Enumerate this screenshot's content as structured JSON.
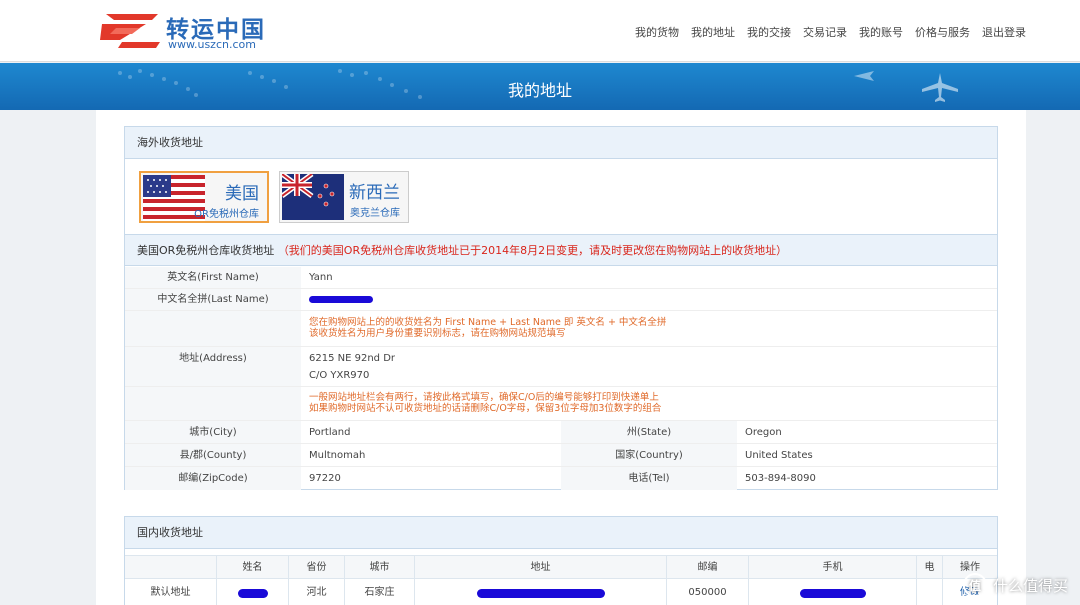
{
  "header": {
    "logo_name": "转运中国",
    "logo_url": "www.uszcn.com",
    "nav": [
      "我的货物",
      "我的地址",
      "我的交接",
      "交易记录",
      "我的账号",
      "价格与服务",
      "退出登录"
    ]
  },
  "banner": {
    "title": "我的地址"
  },
  "overseas": {
    "heading": "海外收货地址",
    "warehouses": [
      {
        "name": "美国",
        "sub": "OR免税州仓库"
      },
      {
        "name": "新西兰",
        "sub": "奥克兰仓库"
      }
    ],
    "address_heading": "美国OR免税州仓库收货地址",
    "address_notice": "（我们的美国OR免税州仓库收货地址已于2014年8月2日变更，请及时更改您在购物网站上的收货地址）",
    "fields": {
      "first_name_label": "英文名(First Name)",
      "first_name": "Yann",
      "last_name_label": "中文名全拼(Last Name)",
      "name_note_1": "您在购物网站上的的收货姓名为 First Name + Last Name 即 英文名 + 中文名全拼",
      "name_note_2": "该收货姓名为用户身份重要识别标志，请在购物网站规范填写",
      "address_label": "地址(Address)",
      "address_line1": "6215 NE 92nd Dr",
      "address_line2": "C/O YXR970",
      "address_note_1": "一般网站地址栏会有两行，请按此格式填写，确保C/O后的编号能够打印到快递单上",
      "address_note_2": "如果购物时网站不认可收货地址的话请删除C/O字母，保留3位字母加3位数字的组合",
      "city_label": "城市(City)",
      "city": "Portland",
      "state_label": "州(State)",
      "state": "Oregon",
      "county_label": "县/郡(County)",
      "county": "Multnomah",
      "country_label": "国家(Country)",
      "country": "United States",
      "zip_label": "邮编(ZipCode)",
      "zip": "97220",
      "tel_label": "电话(Tel)",
      "tel": "503-894-8090"
    }
  },
  "domestic": {
    "heading": "国内收货地址",
    "columns": [
      "姓名",
      "省份",
      "城市",
      "地址",
      "邮编",
      "手机",
      "电",
      "操作"
    ],
    "rows": [
      {
        "label": "默认地址",
        "province": "河北",
        "city": "石家庄",
        "zip": "050000",
        "action": "修改"
      }
    ]
  },
  "watermark": {
    "icon": "值",
    "text": "什么值得买"
  },
  "colors": {
    "brand_blue": "#1e88d0",
    "notice_red": "#d9261c",
    "note_orange": "#e06a2a",
    "redaction": "#1a0ad8"
  }
}
